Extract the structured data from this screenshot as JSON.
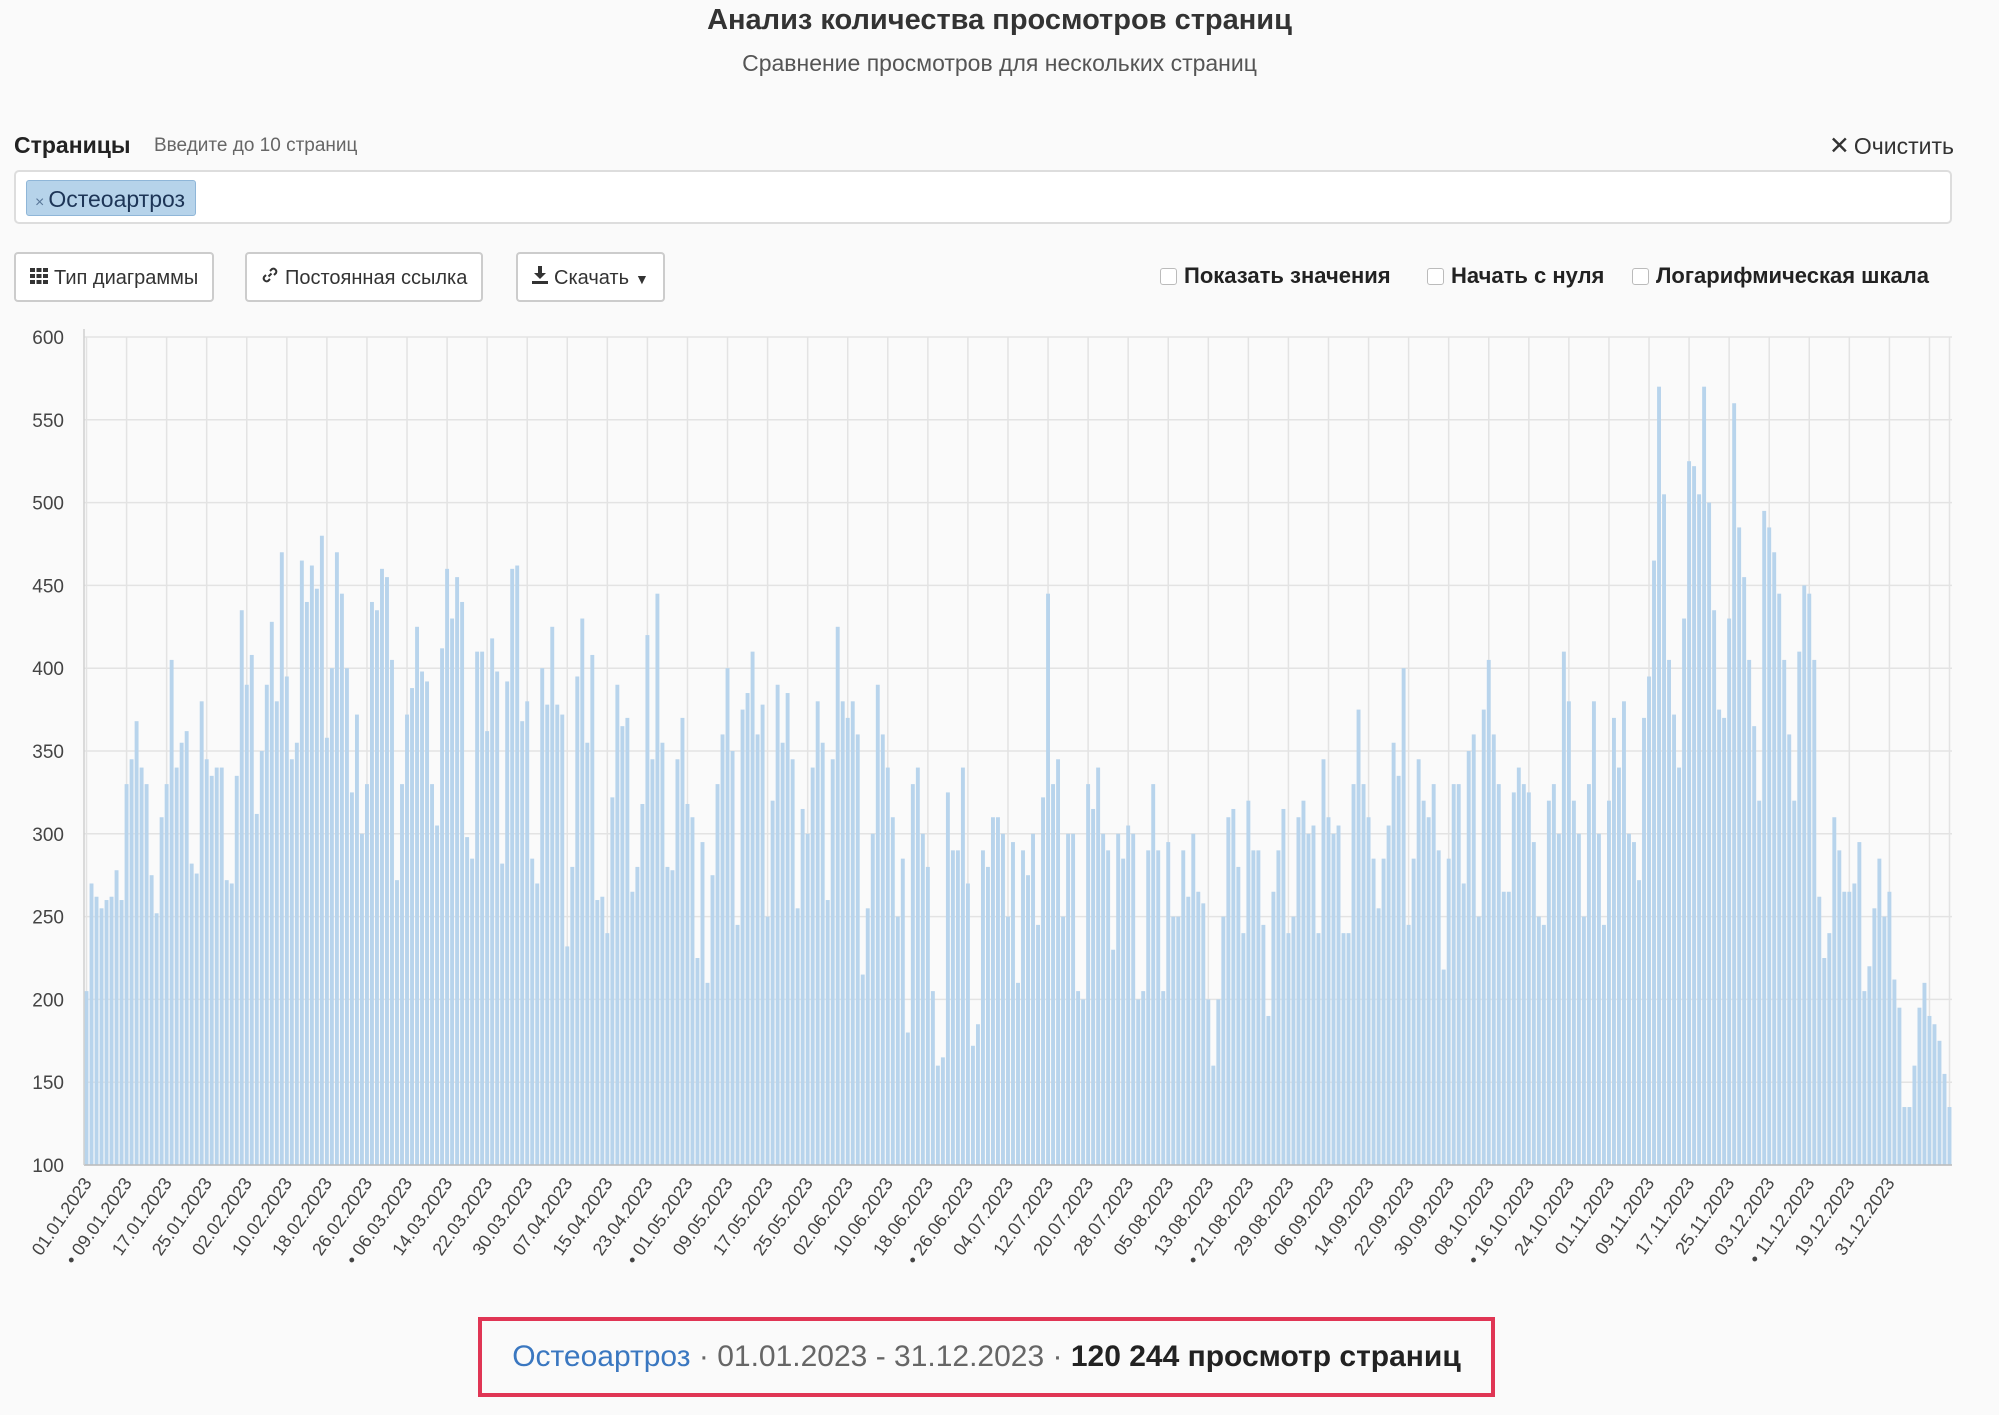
{
  "header": {
    "title": "Анализ количества просмотров страниц",
    "subtitle": "Сравнение просмотров для нескольких страниц"
  },
  "pages": {
    "label": "Страницы",
    "hint": "Введите до 10 страниц",
    "clear_label": "Очистить",
    "selected_tag": "Остеоартроз"
  },
  "toolbar": {
    "chart_type_label": "Тип диаграммы",
    "permalink_label": "Постоянная ссылка",
    "download_label": "Скачать",
    "checkboxes": [
      "Показать значения",
      "Начать с нуля",
      "Логарифмическая шкала"
    ]
  },
  "summary": {
    "page": "Остеоартроз",
    "range": " · 01.01.2023 - 31.12.2023 · ",
    "total": "120 244 просмотр страниц"
  },
  "colors": {
    "bar": "#b8d4ec",
    "tag": "#b6d3ea",
    "link": "#3a77c0",
    "highlight": "#e03554"
  },
  "chart_data": {
    "type": "bar",
    "ylim": [
      100,
      600
    ],
    "yticks": [
      100,
      150,
      200,
      250,
      300,
      350,
      400,
      450,
      500,
      550,
      600
    ],
    "x_start": "01.01.2023",
    "xtick_labels": [
      "01.01.2023",
      "• 09.01.2023",
      "17.01.2023",
      "25.01.2023",
      "02.02.2023",
      "10.02.2023",
      "18.02.2023",
      "26.02.2023",
      "• 06.03.2023",
      "14.03.2023",
      "22.03.2023",
      "30.03.2023",
      "07.04.2023",
      "15.04.2023",
      "23.04.2023",
      "• 01.05.2023",
      "09.05.2023",
      "17.05.2023",
      "25.05.2023",
      "02.06.2023",
      "10.06.2023",
      "18.06.2023",
      "• 26.06.2023",
      "04.07.2023",
      "12.07.2023",
      "20.07.2023",
      "28.07.2023",
      "05.08.2023",
      "13.08.2023",
      "• 21.08.2023",
      "29.08.2023",
      "06.09.2023",
      "14.09.2023",
      "22.09.2023",
      "30.09.2023",
      "08.10.2023",
      "• 16.10.2023",
      "24.10.2023",
      "01.11.2023",
      "09.11.2023",
      "17.11.2023",
      "25.11.2023",
      "03.12.2023",
      "• 11.12.2023",
      "19.12.2023",
      "31.12.2023"
    ],
    "monthly_values": [
      [
        205,
        270,
        262,
        255,
        260,
        262,
        278,
        260,
        330,
        345,
        368,
        340,
        330,
        275,
        252,
        310,
        330,
        405,
        340,
        355,
        362,
        282,
        276,
        380,
        345,
        335,
        340,
        340,
        272,
        270,
        335
      ],
      [
        435,
        390,
        408,
        312,
        350,
        390,
        428,
        380,
        470,
        395,
        345,
        355,
        465,
        440,
        462,
        448,
        480,
        358,
        400,
        470,
        445,
        400,
        325,
        372,
        300,
        330,
        440,
        435,
        460,
        455,
        405
      ],
      [
        272,
        330,
        372,
        388,
        425,
        398,
        392,
        330,
        305,
        412,
        460,
        430,
        455,
        440,
        298,
        285,
        410,
        410,
        362,
        418,
        398,
        282,
        392,
        460,
        462,
        368,
        380,
        285,
        270,
        400
      ],
      [
        378,
        425,
        378,
        372,
        232,
        280,
        395,
        430,
        355,
        408,
        260,
        262,
        240,
        322,
        390,
        365,
        370,
        265,
        280,
        318,
        420,
        345,
        445,
        355,
        280,
        278,
        345,
        370,
        318,
        310,
        225,
        295
      ],
      [
        210,
        275,
        330,
        360,
        400,
        350,
        245,
        375,
        385,
        410,
        360,
        378,
        250,
        320,
        390,
        355,
        385,
        345,
        255,
        315,
        300,
        340,
        380,
        355,
        260,
        345,
        425,
        380,
        370,
        380,
        360,
        215
      ],
      [
        255,
        300,
        390,
        360,
        340,
        310,
        250,
        285,
        180,
        330,
        340,
        300,
        280,
        205,
        160,
        165,
        325,
        290,
        290,
        340,
        270,
        172,
        185,
        290,
        280,
        310,
        310,
        300,
        250,
        295,
        210
      ],
      [
        290,
        275,
        300,
        245,
        322,
        445,
        330,
        345,
        250,
        300,
        300,
        205,
        200,
        330,
        315,
        340,
        300,
        290,
        230,
        300,
        285,
        305,
        300,
        200,
        205,
        290,
        330,
        290,
        205,
        295,
        250
      ],
      [
        250,
        290,
        262,
        300,
        265,
        258,
        200,
        160,
        200,
        250,
        310,
        315,
        280,
        240,
        320,
        290,
        290,
        245,
        190,
        265,
        290,
        315,
        240,
        250,
        310,
        320,
        300,
        305,
        240,
        345,
        310
      ],
      [
        300,
        305,
        240,
        240,
        330,
        375,
        330,
        310,
        285,
        255,
        285,
        305,
        355,
        335,
        400,
        245,
        285,
        345,
        320,
        310,
        330,
        290,
        218,
        285,
        330,
        330,
        270,
        350,
        360,
        250,
        375
      ],
      [
        405,
        360,
        330,
        265,
        265,
        325,
        340,
        330,
        325,
        295,
        250,
        245,
        320,
        330,
        300,
        410,
        380,
        320,
        300,
        250,
        330,
        380,
        300,
        245,
        320,
        370,
        340,
        380,
        300,
        295,
        272
      ],
      [
        370,
        395,
        465,
        570,
        505,
        405,
        372,
        340,
        430,
        525,
        522,
        505,
        570,
        500,
        435,
        375,
        370,
        430,
        560,
        485,
        455,
        405,
        365,
        320,
        495,
        485,
        470,
        445,
        405,
        360,
        320
      ],
      [
        410,
        450,
        445,
        405,
        262,
        225,
        240,
        310,
        290,
        265,
        265,
        270,
        295,
        205,
        220,
        255,
        285,
        250,
        265,
        212,
        195,
        135,
        135,
        160,
        195,
        210,
        190,
        185,
        175,
        155,
        135
      ]
    ]
  }
}
